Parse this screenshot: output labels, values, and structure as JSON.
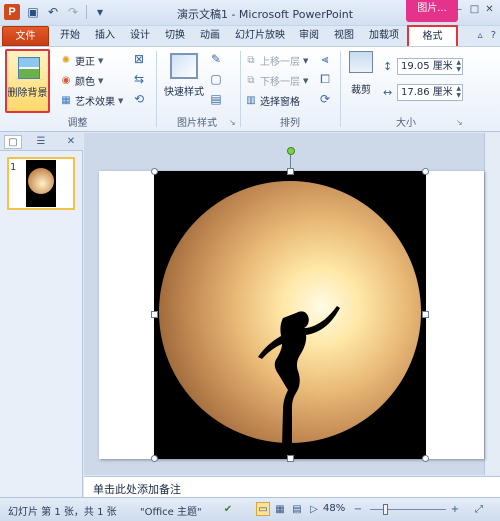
{
  "titlebar": {
    "logo": "P",
    "title": "演示文稿1 - Microsoft PowerPoint",
    "context_tab_title": "图片...",
    "qat": {
      "save_icon": "save-icon",
      "undo_icon": "undo-icon",
      "redo_icon": "redo-icon"
    },
    "window_buttons": {
      "minimize": "–",
      "maximize": "□",
      "close": "✕"
    }
  },
  "tabs": [
    "文件",
    "开始",
    "插入",
    "设计",
    "切换",
    "动画",
    "幻灯片放映",
    "审阅",
    "视图",
    "加载项",
    "格式"
  ],
  "ribbon": {
    "adjust": {
      "remove_bg": "删除背景",
      "corrections": "更正",
      "color": "颜色",
      "artistic": "艺术效果",
      "label": "调整"
    },
    "picture_styles": {
      "quick_styles": "快速样式",
      "label": "图片样式"
    },
    "arrange": {
      "bring_forward": "上移一层",
      "send_backward": "下移一层",
      "selection_pane": "选择窗格",
      "label": "排列"
    },
    "size": {
      "crop": "裁剪",
      "height": "19.05 厘米",
      "width": "17.86 厘米",
      "label": "大小"
    }
  },
  "slide_panel": {
    "slide_number": "1"
  },
  "notes": {
    "placeholder": "单击此处添加备注"
  },
  "status": {
    "slide_info": "幻灯片 第 1 张，共 1 张",
    "theme": "\"Office 主题\"",
    "zoom": "48%",
    "zoom_minus": "−",
    "zoom_plus": "+"
  },
  "colors": {
    "file_tab": "#d04a1e",
    "context_tab": "#e4338a",
    "highlight_box": "#e3343c"
  }
}
